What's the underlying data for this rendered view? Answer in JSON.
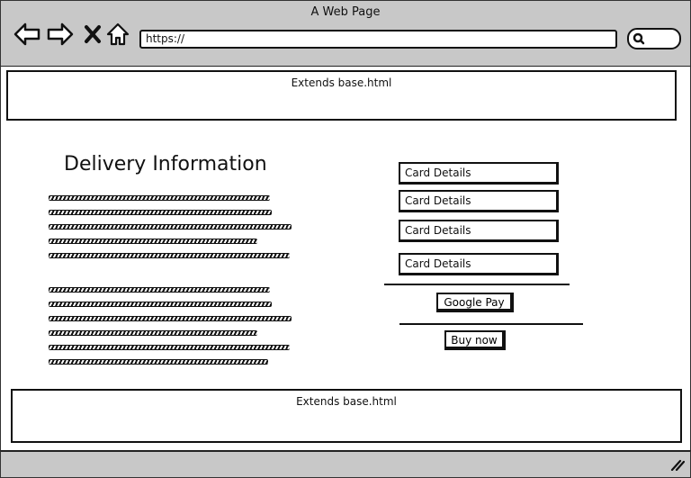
{
  "window": {
    "title": "A Web Page"
  },
  "toolbar": {
    "url": "https://"
  },
  "icons": [
    "back-arrow-icon",
    "forward-arrow-icon",
    "close-x-icon",
    "home-icon",
    "search-icon",
    "resize-grip-icon"
  ],
  "header": {
    "label": "Extends base.html"
  },
  "main": {
    "heading": "Delivery Information",
    "paragraph_lines": [
      5,
      6
    ]
  },
  "form": {
    "fields": [
      "Card Details",
      "Card Details",
      "Card Details",
      "Card Details"
    ],
    "google_pay_label": "Google Pay",
    "buy_now_label": "Buy now"
  },
  "footer": {
    "label": "Extends base.html"
  }
}
